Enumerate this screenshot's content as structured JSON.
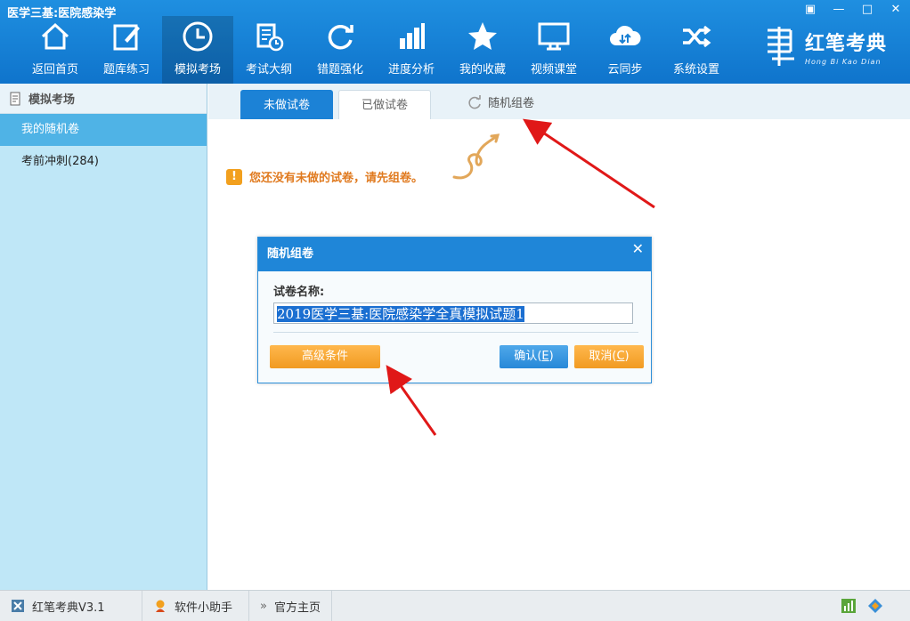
{
  "window": {
    "title": "医学三基:医院感染学",
    "controls": [
      "▣",
      "—",
      "□",
      "✕"
    ]
  },
  "nav": [
    {
      "label": "返回首页",
      "icon": "home-icon"
    },
    {
      "label": "题库练习",
      "icon": "edit-icon"
    },
    {
      "label": "模拟考场",
      "icon": "clock-icon",
      "active": true
    },
    {
      "label": "考试大纲",
      "icon": "outline-icon"
    },
    {
      "label": "错题强化",
      "icon": "refresh-icon"
    },
    {
      "label": "进度分析",
      "icon": "bar-chart-icon"
    },
    {
      "label": "我的收藏",
      "icon": "star-icon"
    },
    {
      "label": "视频课堂",
      "icon": "monitor-icon"
    },
    {
      "label": "云同步",
      "icon": "cloud-sync-icon"
    },
    {
      "label": "系统设置",
      "icon": "shuffle-icon"
    }
  ],
  "brand": {
    "name": "红笔考典",
    "pinyin": "Hong Bi Kao Dian"
  },
  "sidebar": {
    "title": "模拟考场",
    "items": [
      {
        "label": "我的随机卷",
        "active": true
      },
      {
        "label": "考前冲刺(284)"
      }
    ]
  },
  "tabs": {
    "undone": "未做试卷",
    "done": "已做试卷",
    "random": "随机组卷"
  },
  "notice": "您还没有未做的试卷，请先组卷。",
  "dialog": {
    "title": "随机组卷",
    "field_label": "试卷名称:",
    "field_value": "2019医学三基:医院感染学全真模拟试题1",
    "advanced": "高级条件",
    "ok": "确认",
    "ok_key": "E",
    "cancel": "取消",
    "cancel_key": "C"
  },
  "statusbar": {
    "version": "红笔考典V3.1",
    "helper": "软件小助手",
    "homepage": "官方主页"
  }
}
